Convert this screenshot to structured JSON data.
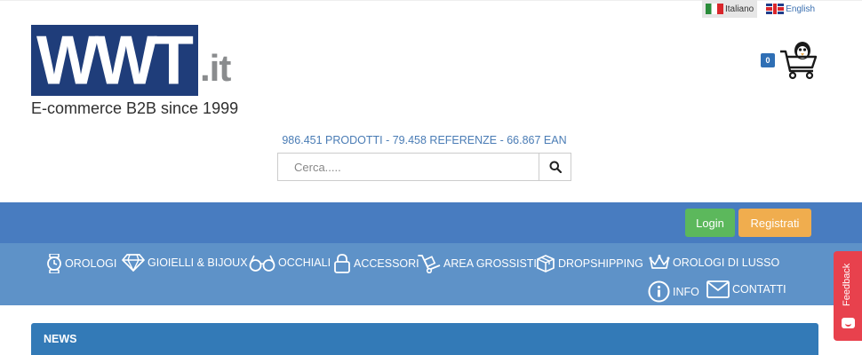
{
  "languages": [
    {
      "label": "Italiano",
      "flag": "italy-flag-icon",
      "active": true
    },
    {
      "label": "English",
      "flag": "uk-flag-icon",
      "active": false
    }
  ],
  "logo": {
    "letters": "WWT",
    "ext": ".it",
    "tagline": "E-commerce B2B since 1999",
    "colors": {
      "box": "#1f3d7a",
      "ext": "#8a8c8e"
    }
  },
  "cart": {
    "count": "0",
    "icon": "shopping-cart-icon"
  },
  "stats": "986.451 PRODOTTI - 79.458 REFERENZE - 66.867 EAN",
  "search": {
    "placeholder": "Cerca.....",
    "value": "",
    "icon": "search-icon"
  },
  "auth": {
    "login": "Login",
    "register": "Registrati"
  },
  "nav": [
    {
      "label": "OROLOGI",
      "icon": "watch-icon"
    },
    {
      "label": "GIOIELLI & BIJOUX",
      "icon": "diamond-icon"
    },
    {
      "label": "OCCHIALI",
      "icon": "glasses-icon"
    },
    {
      "label": "ACCESSORI",
      "icon": "bag-icon"
    },
    {
      "label": "AREA GROSSISTI",
      "icon": "hand-truck-icon"
    },
    {
      "label": "DROPSHIPPING",
      "icon": "box-icon"
    },
    {
      "label": "OROLOGI DI LUSSO",
      "icon": "crown-icon"
    },
    {
      "label": "INFO",
      "icon": "info-icon"
    },
    {
      "label": "CONTATTI",
      "icon": "envelope-icon"
    }
  ],
  "news": {
    "title": "NEWS"
  },
  "feedback": {
    "label": "Feedback"
  },
  "colors": {
    "topbar": "#487cc0",
    "catnav": "#5e92c8",
    "login": "#5cb85c",
    "register": "#f0ad4e",
    "news": "#337ab7",
    "feedback": "#e8414d",
    "stats": "#4a7cb5"
  }
}
